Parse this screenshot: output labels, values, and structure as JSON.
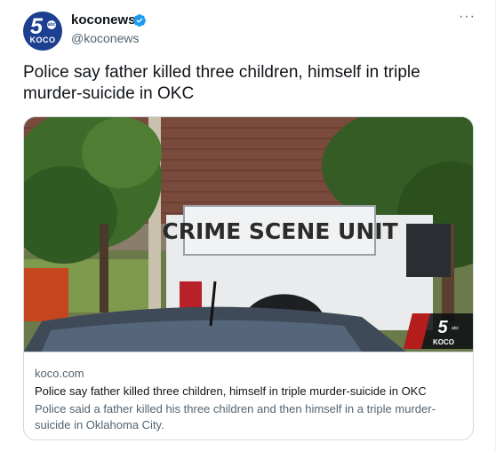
{
  "author": {
    "name": "koconews",
    "handle": "@koconews",
    "avatar": {
      "number": "5",
      "network": "abc",
      "station": "KOCO"
    }
  },
  "more_menu": "···",
  "tweet_text": "Police say father killed three children, himself in triple murder-suicide in OKC",
  "link_card": {
    "image_truck_text": "CRIME SCENE UNIT",
    "image_watermark": {
      "number": "5",
      "network": "abc",
      "station": "KOCO"
    },
    "domain": "koco.com",
    "title": "Police say father killed three children, himself in triple murder-suicide in OKC",
    "description": "Police said a father killed his three children and then himself in a triple murder-suicide in Oklahoma City."
  },
  "colors": {
    "verified": "#1d9bf0",
    "avatar_bg": "#1d3f8f",
    "secondary_text": "#536471"
  }
}
